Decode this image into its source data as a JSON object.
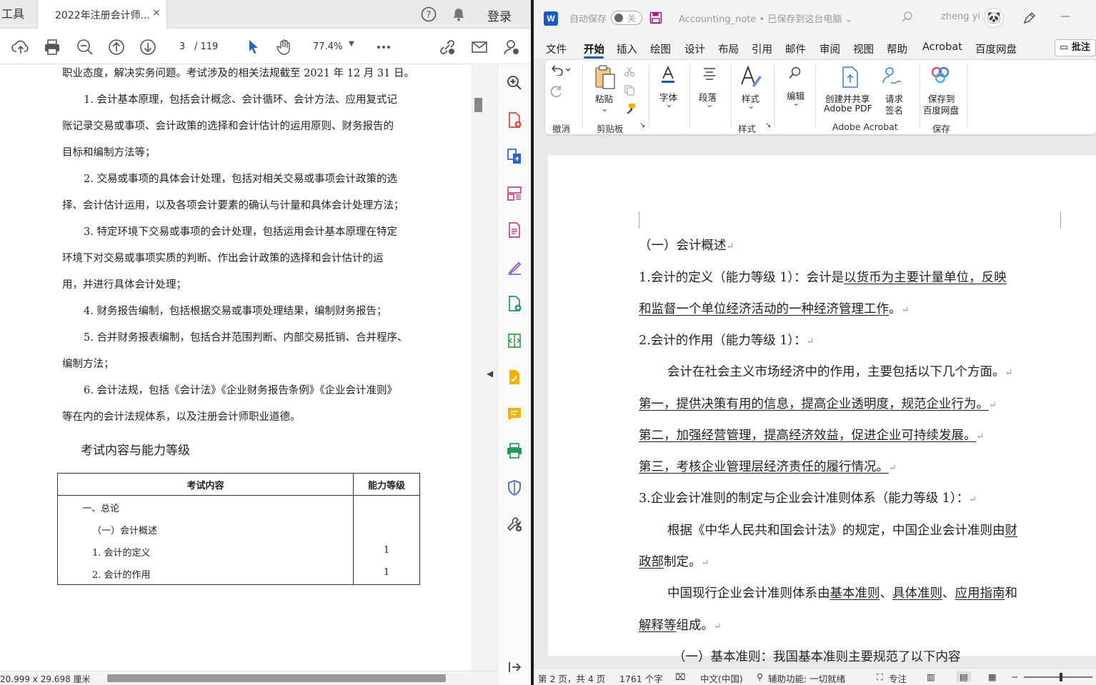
{
  "pdf": {
    "tab_prev_label": "工具",
    "tab_title": "2022年注册会计师...",
    "tab_close": "×",
    "login": "登录",
    "page_current": "3",
    "page_total": "/ 119",
    "zoom": "77.4%",
    "page_size": "20.999 x 29.698 厘米",
    "body_lines": [
      "职业态度，解决实务问题。考试涉及的相关法规截至 2021 年 12 月 31 日。",
      "1. 会计基本原理，包括会计概念、会计循环、会计方法、应用复式记",
      "账记录交易或事项、会计政策的选择和会计估计的运用原则、财务报告的",
      "目标和编制方法等；",
      "2. 交易或事项的具体会计处理，包括对相关交易或事项会计政策的选",
      "择、会计估计运用，以及各项会计要素的确认与计量和具体会计处理方法；",
      "3. 特定环境下交易或事项的会计处理，包括运用会计基本原理在特定",
      "环境下对交易或事项实质的判断、作出会计政策的选择和会计估计的运",
      "用，并进行具体会计处理；",
      "4. 财务报告编制，包括根据交易或事项处理结果，编制财务报告；",
      "5. 合并财务报表编制，包括合并范围判断、内部交易抵销、合并程序、",
      "编制方法；",
      "6. 会计法规，包括《会计法》《企业财务报告条例》《企业会计准则》",
      "等在内的会计法规体系，以及注册会计师职业道德。"
    ],
    "heading": "考试内容与能力等级",
    "table": {
      "col1": "考试内容",
      "col2": "能力等级",
      "rows": [
        {
          "content": "一、总论",
          "level": ""
        },
        {
          "content": "（一）会计概述",
          "level": ""
        },
        {
          "content": "1. 会计的定义",
          "level": "1"
        },
        {
          "content": "2. 会计的作用",
          "level": "1"
        }
      ]
    }
  },
  "word": {
    "app_letter": "W",
    "autosave_label": "自动保存",
    "autosave_state": "关",
    "doc_title": "Accounting_note • 已保存到这台电脑 ⌄",
    "user": "zheng yi",
    "menu": [
      "文件",
      "开始",
      "插入",
      "绘图",
      "设计",
      "布局",
      "引用",
      "邮件",
      "审阅",
      "视图",
      "帮助",
      "Acrobat",
      "百度网盘"
    ],
    "comment_btn": "批注",
    "ribbon": {
      "undo_group": "撤消",
      "paste": "粘贴",
      "clipboard_group": "剪贴板",
      "font": "字体",
      "paragraph": "段落",
      "styles": "样式",
      "styles_group": "样式",
      "edit": "编辑",
      "create_share_1": "创建并共享",
      "create_share_2": "Adobe PDF",
      "request_sign_1": "请求",
      "request_sign_2": "签名",
      "acrobat_group": "Adobe Acrobat",
      "save_baidu_1": "保存到",
      "save_baidu_2": "百度网盘",
      "save_group": "保存"
    },
    "doc": {
      "l1": "（一）会计概述",
      "l2a": "1.会计的定义（能力等级 1）：会计是",
      "l2b": "以货币为主要计量单位，反映",
      "l3": "和监督一个单位经济活动的一种经济管理工作",
      "l3end": "。",
      "l4": "2.会计的作用（能力等级 1）：",
      "l5": "会计在社会主义市场经济中的作用，主要包括以下几个方面。",
      "l6": "第一，提供决策有用的信息，提高企业透明度，规范企业行为。",
      "l7": "第二，加强经营管理，提高经济效益，促进企业可持续发展。",
      "l8": "第三，考核企业管理层经济责任的履行情况。",
      "l9": "3.企业会计准则的制定与企业会计准则体系（能力等级 1）：",
      "l10a": "根据《中华人民共和国会计法》的规定，中国企业会计准则由",
      "l10b": "财",
      "l11a": "政部",
      "l11b": "制定。",
      "l12a": "中国现行企业会计准则体系由",
      "l12b": "基本准则",
      "l12c": "、",
      "l12d": "具体准则",
      "l12e": "、",
      "l12f": "应用指南",
      "l12g": "和",
      "l13a": "解释等",
      "l13b": "组成。",
      "l14": "（一）基本准则：我国基本准则主要规范了以下内容",
      "para_mark": "↵"
    },
    "status": {
      "page": "第 2 页，共 4 页",
      "words": "1761 个字",
      "lang": "中文(中国)",
      "accessibility": "辅助功能: 一切就绪",
      "focus": "专注"
    }
  }
}
